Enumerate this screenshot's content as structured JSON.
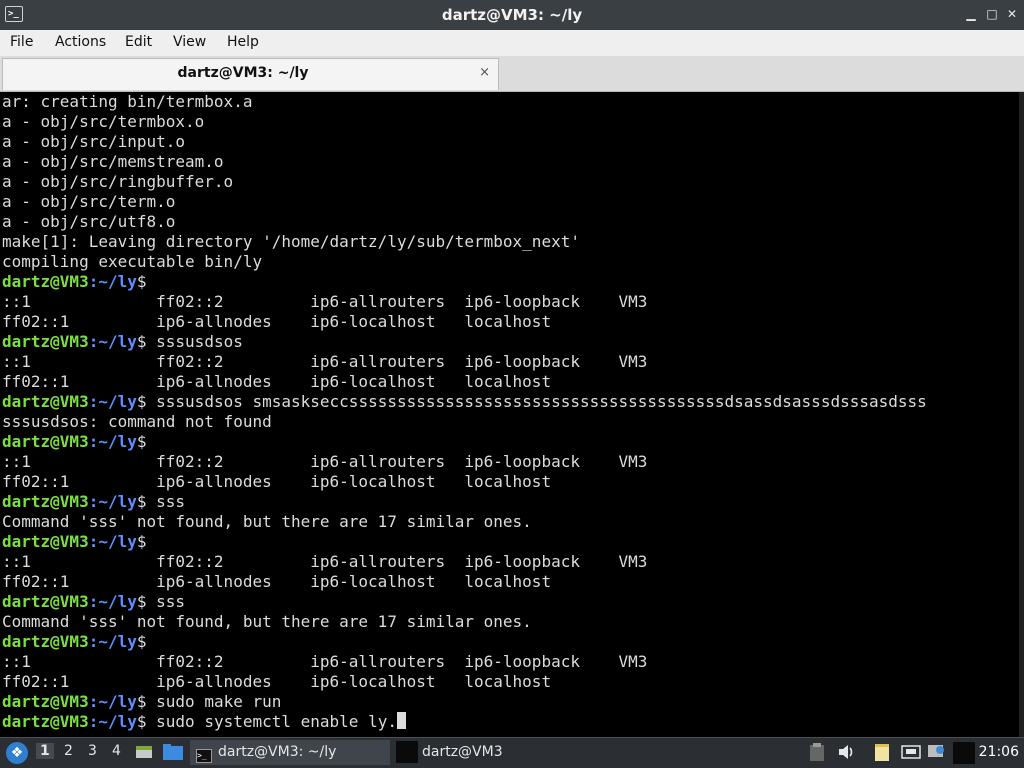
{
  "window": {
    "title": "dartz@VM3: ~/ly",
    "app_icon": ">_"
  },
  "menu": [
    "File",
    "Actions",
    "Edit",
    "View",
    "Help"
  ],
  "tab": {
    "label": "dartz@VM3: ~/ly",
    "close": "×"
  },
  "prompt": {
    "user": "dartz@VM3",
    "path": ":~/ly",
    "symbol": "$"
  },
  "terminal": {
    "lines": [
      {
        "text": "ar: creating bin/termbox.a"
      },
      {
        "text": "a - obj/src/termbox.o"
      },
      {
        "text": "a - obj/src/input.o"
      },
      {
        "text": "a - obj/src/memstream.o"
      },
      {
        "text": "a - obj/src/ringbuffer.o"
      },
      {
        "text": "a - obj/src/term.o"
      },
      {
        "text": "a - obj/src/utf8.o"
      },
      {
        "text": "make[1]: Leaving directory '/home/dartz/ly/sub/termbox_next'"
      },
      {
        "text": "compiling executable bin/ly"
      },
      {
        "prompt": true,
        "cmd": ""
      },
      {
        "text": "::1             ff02::2         ip6-allrouters  ip6-loopback    VM3"
      },
      {
        "text": "ff02::1         ip6-allnodes    ip6-localhost   localhost"
      },
      {
        "prompt": true,
        "cmd": " sssusdsos"
      },
      {
        "text": "::1             ff02::2         ip6-allrouters  ip6-loopback    VM3"
      },
      {
        "text": "ff02::1         ip6-allnodes    ip6-localhost   localhost"
      },
      {
        "prompt": true,
        "cmd": " sssusdsos smsaskseссsssssssssssssssssssssssssssssssssssssssdsassdsasssdsssasdsss"
      },
      {
        "text": "sssusdsos: command not found"
      },
      {
        "prompt": true,
        "cmd": ""
      },
      {
        "text": "::1             ff02::2         ip6-allrouters  ip6-loopback    VM3"
      },
      {
        "text": "ff02::1         ip6-allnodes    ip6-localhost   localhost"
      },
      {
        "prompt": true,
        "cmd": " sss"
      },
      {
        "text": "Command 'sss' not found, but there are 17 similar ones."
      },
      {
        "prompt": true,
        "cmd": ""
      },
      {
        "text": "::1             ff02::2         ip6-allrouters  ip6-loopback    VM3"
      },
      {
        "text": "ff02::1         ip6-allnodes    ip6-localhost   localhost"
      },
      {
        "prompt": true,
        "cmd": " sss"
      },
      {
        "text": "Command 'sss' not found, but there are 17 similar ones."
      },
      {
        "prompt": true,
        "cmd": ""
      },
      {
        "text": "::1             ff02::2         ip6-allrouters  ip6-loopback    VM3"
      },
      {
        "text": "ff02::1         ip6-allnodes    ip6-localhost   localhost"
      },
      {
        "prompt": true,
        "cmd": " sudo make run"
      },
      {
        "prompt": true,
        "cmd": " sudo systemctl enable ly.",
        "cursor": true
      }
    ]
  },
  "taskbar": {
    "workspaces": [
      "1",
      "2",
      "3",
      "4"
    ],
    "tasks": [
      {
        "label": "dartz@VM3: ~/ly",
        "active": true
      },
      {
        "label": "dartz@VM3",
        "active": false
      }
    ],
    "clock": "21:06"
  },
  "colors": {
    "prompt_user": "#7ae03d",
    "prompt_path": "#5f8fff",
    "terminal_bg": "#000000",
    "terminal_fg": "#dcdcdc"
  }
}
